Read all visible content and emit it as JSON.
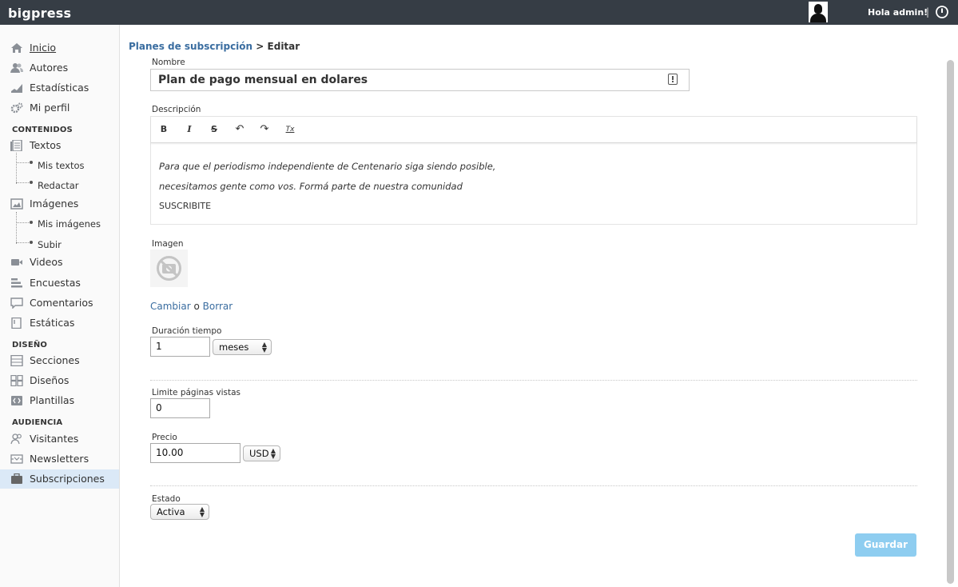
{
  "app": {
    "brand": "bigpress",
    "greeting": "Hola admin!",
    "separator": "|"
  },
  "sidebar": {
    "items": {
      "inicio": "Inicio",
      "autores": "Autores",
      "estadisticas": "Estadísticas",
      "perfil": "Mi perfil",
      "textos": "Textos",
      "mis_textos": "Mis textos",
      "redactar": "Redactar",
      "imagenes": "Imágenes",
      "mis_imagenes": "Mis imágenes",
      "subir": "Subir",
      "videos": "Videos",
      "encuestas": "Encuestas",
      "comentarios": "Comentarios",
      "estaticas": "Estáticas",
      "secciones": "Secciones",
      "disenos": "Diseños",
      "plantillas": "Plantillas",
      "visitantes": "Visitantes",
      "newsletters": "Newsletters",
      "subscripciones": "Subscripciones"
    },
    "sections": {
      "contenidos": "CONTENIDOS",
      "diseno": "DISEÑO",
      "audiencia": "AUDIENCIA"
    },
    "active": "Subscripciones"
  },
  "breadcrumb": {
    "parent": "Planes de subscripción",
    "separator": ">",
    "current": "Editar"
  },
  "form": {
    "nombre_label": "Nombre",
    "nombre_value": "Plan de pago mensual en dolares",
    "descripcion_label": "Descripción",
    "toolbar": {
      "bold": "B",
      "italic": "I",
      "strike": "S",
      "undo": "↶",
      "redo": "↷",
      "clear": "Tx"
    },
    "descripcion_lines": [
      "Para que el periodismo independiente de Centenario siga siendo posible,",
      "necesitamos gente como vos. Formá parte de nuestra comunidad",
      "SUSCRIBITE"
    ],
    "imagen_label": "Imagen",
    "cambiar": "Cambiar",
    "o": "o",
    "borrar": "Borrar",
    "duracion_label": "Duración tiempo",
    "duracion_value": "1",
    "duracion_unit": "meses",
    "limite_label": "Limite páginas vistas",
    "limite_value": "0",
    "precio_label": "Precio",
    "precio_value": "10.00",
    "moneda": "USD",
    "estado_label": "Estado",
    "estado_value": "Activa",
    "save": "Guardar"
  },
  "colors": {
    "topbar": "#363d45",
    "link": "#3a6da0",
    "active_nav": "#dbe9f7",
    "save_button": "#8ecdf0"
  }
}
